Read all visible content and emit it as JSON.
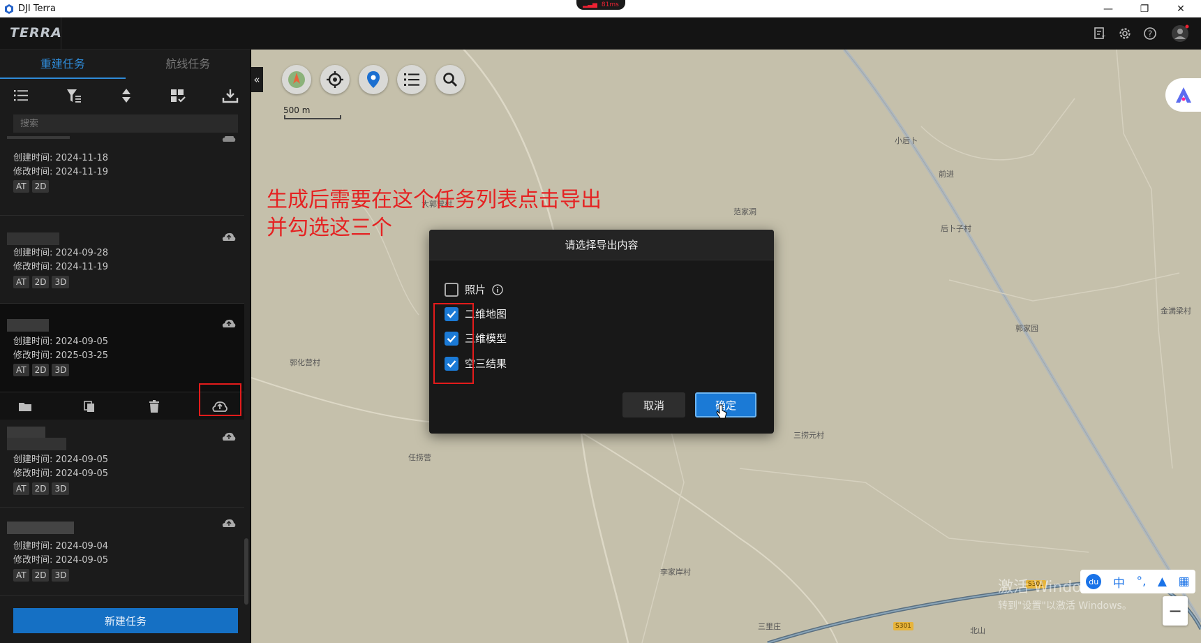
{
  "window": {
    "title": "DJI Terra",
    "net_indicator": "81ms",
    "controls": [
      "—",
      "❐",
      "✕"
    ]
  },
  "appbar": {
    "brand": "TERRA",
    "icons": [
      "task-list-icon",
      "gear-icon",
      "help-icon",
      "account-icon"
    ]
  },
  "sidebar": {
    "tabs": [
      {
        "label": "重建任务",
        "active": true
      },
      {
        "label": "航线任务",
        "active": false
      }
    ],
    "toolbar_icons": [
      "list-icon",
      "filter-icon",
      "sort-icon",
      "multi-select-icon",
      "import-icon"
    ],
    "search_placeholder": "搜索",
    "tasks": [
      {
        "created": "创建时间: 2024-11-18",
        "modified": "修改时间: 2024-11-19",
        "tags": [
          "AT",
          "2D"
        ]
      },
      {
        "created": "创建时间: 2024-09-28",
        "modified": "修改时间: 2024-11-19",
        "tags": [
          "AT",
          "2D",
          "3D"
        ]
      },
      {
        "created": "创建时间: 2024-09-05",
        "modified": "修改时间: 2025-03-25",
        "tags": [
          "AT",
          "2D",
          "3D"
        ],
        "selected": true
      },
      {
        "created": "创建时间: 2024-09-05",
        "modified": "修改时间: 2024-09-05",
        "tags": [
          "AT",
          "2D",
          "3D"
        ]
      },
      {
        "created": "创建时间: 2024-09-04",
        "modified": "修改时间: 2024-09-05",
        "tags": [
          "AT",
          "2D",
          "3D"
        ]
      }
    ],
    "action_icons": [
      "folder-icon",
      "copy-icon",
      "delete-icon",
      "export-icon"
    ],
    "new_task_label": "新建任务"
  },
  "map": {
    "scale_label": "500 m",
    "tool_icons": [
      "compass-icon",
      "locate-icon",
      "pin-icon",
      "layers-list-icon",
      "search-icon"
    ],
    "place_labels": [
      "小后卜",
      "前进",
      "范家洞",
      "后卜子村",
      "金満梁村",
      "郭家园",
      "郭化营村",
      "任捞营",
      "三捞元村",
      "李家岸村",
      "三里庄",
      "北山",
      "大郭营村"
    ],
    "road_badges": [
      "S301",
      "S301"
    ],
    "zoom_out": "−"
  },
  "annotation": {
    "line1": "生成后需要在这个任务列表点击导出",
    "line2": "并勾选这三个"
  },
  "dialog": {
    "title": "请选择导出内容",
    "options": [
      {
        "label": "照片",
        "checked": false,
        "info": true
      },
      {
        "label": "二维地图",
        "checked": true
      },
      {
        "label": "三维模型",
        "checked": true
      },
      {
        "label": "空三结果",
        "checked": true
      }
    ],
    "cancel_label": "取消",
    "ok_label": "确定"
  },
  "ime": {
    "mode": "中",
    "punct": "°,"
  },
  "watermark": {
    "line1": "激活 Windows",
    "line2": "转到\"设置\"以激活 Windows。"
  },
  "colors": {
    "accent": "#1b7ad6",
    "annotation": "#e52222",
    "map_bg": "#c5c0ab"
  }
}
